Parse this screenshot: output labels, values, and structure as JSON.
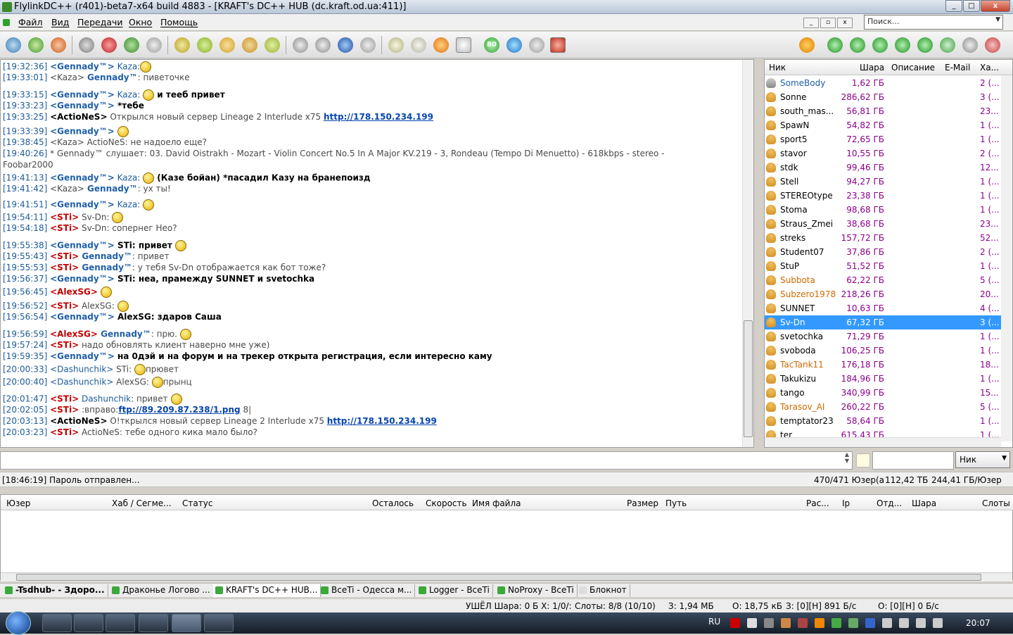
{
  "window": {
    "title": "FlylinkDC++ (r401)-beta7-x64 build 4883 - [KRAFT's DC++ HUB (dc.kraft.od.ua:411)]"
  },
  "menu": [
    "Файл",
    "Вид",
    "Передачи",
    "Окно",
    "Помощь"
  ],
  "search": {
    "placeholder": "Поиск..."
  },
  "toolbar": {
    "badge": "80"
  },
  "chat": [
    {
      "ts": "[19:32:36]",
      "parts": [
        [
          "n",
          "<Gennady™>"
        ],
        [
          "c",
          " Kaza:"
        ],
        [
          "s",
          ""
        ]
      ]
    },
    {
      "ts": "[19:33:01]",
      "parts": [
        [
          "g",
          "<Kaza>"
        ],
        [
          "n",
          " Gennady™"
        ],
        [
          "g",
          ": пиветочке"
        ]
      ]
    },
    {
      "ts": "[19:33:15]",
      "parts": [
        [
          "n",
          "<Gennady™>"
        ],
        [
          "c",
          " Kaza: "
        ],
        [
          "s",
          ""
        ],
        [
          "b",
          " и тееб привет"
        ]
      ]
    },
    {
      "ts": "[19:33:23]",
      "parts": [
        [
          "n",
          "<Gennady™>"
        ],
        [
          "b",
          " *тебе"
        ]
      ]
    },
    {
      "ts": "[19:33:25]",
      "parts": [
        [
          "b",
          "<ActioNeS>"
        ],
        [
          "g",
          " Открылся новый сервер Lineage 2 Interlude x75 "
        ],
        [
          "l",
          "http://178.150.234.199"
        ]
      ]
    },
    {
      "ts": "[19:33:39]",
      "parts": [
        [
          "n",
          "<Gennady™>"
        ],
        [
          "b",
          "  "
        ],
        [
          "s",
          ""
        ]
      ]
    },
    {
      "ts": "[19:38:45]",
      "parts": [
        [
          "g",
          "<Kaza>"
        ],
        [
          "g",
          " ActioNeS: не надоело еще?"
        ]
      ]
    },
    {
      "ts": "[19:40:26]",
      "parts": [
        [
          "g",
          " * Gennady™ слушает: 03. David Oistrakh - Mozart - Violin Concert No.5 In A Major KV.219 - 3, Rondeau (Tempo Di Menuetto) - 618kbps - stereo -"
        ]
      ]
    },
    {
      "ts": "",
      "parts": [
        [
          "g",
          "Foobar2000"
        ]
      ]
    },
    {
      "ts": "[19:41:13]",
      "parts": [
        [
          "n",
          "<Gennady™>"
        ],
        [
          "c",
          " Kaza: "
        ],
        [
          "s",
          ""
        ],
        [
          "b",
          " (Казе бойан) *пасадил Казу на бранепоизд"
        ]
      ]
    },
    {
      "ts": "[19:41:42]",
      "parts": [
        [
          "g",
          "<Kaza>"
        ],
        [
          "n",
          " Gennady™"
        ],
        [
          "g",
          ": ух ты!"
        ]
      ]
    },
    {
      "ts": "[19:41:51]",
      "parts": [
        [
          "n",
          "<Gennady™>"
        ],
        [
          "c",
          " Kaza: "
        ],
        [
          "s",
          ""
        ]
      ]
    },
    {
      "ts": "[19:54:11]",
      "parts": [
        [
          "r",
          "<STi>"
        ],
        [
          "g",
          " Sv-Dn: "
        ],
        [
          "s",
          ""
        ]
      ]
    },
    {
      "ts": "[19:54:18]",
      "parts": [
        [
          "r",
          "<STi>"
        ],
        [
          "g",
          " Sv-Dn: сопернег Нео?"
        ]
      ]
    },
    {
      "ts": "[19:55:38]",
      "parts": [
        [
          "n",
          "<Gennady™>"
        ],
        [
          "b",
          " STi: привет "
        ],
        [
          "s",
          ""
        ]
      ]
    },
    {
      "ts": "[19:55:43]",
      "parts": [
        [
          "r",
          "<STi>"
        ],
        [
          "n",
          " Gennady™"
        ],
        [
          "g",
          ": привет"
        ]
      ]
    },
    {
      "ts": "[19:55:53]",
      "parts": [
        [
          "r",
          "<STi>"
        ],
        [
          "n",
          " Gennady™"
        ],
        [
          "g",
          ": у тебя Sv-Dn отображается как бот тоже?"
        ]
      ]
    },
    {
      "ts": "[19:56:37]",
      "parts": [
        [
          "n",
          "<Gennady™>"
        ],
        [
          "b",
          " STi:  неа, прамежду SUNNET и svetochka"
        ]
      ]
    },
    {
      "ts": "[19:56:45]",
      "parts": [
        [
          "r",
          "<AlexSG>"
        ],
        [
          "g",
          " "
        ],
        [
          "s",
          ""
        ]
      ]
    },
    {
      "ts": "[19:56:52]",
      "parts": [
        [
          "r",
          "<STi>"
        ],
        [
          "g",
          " AlexSG: "
        ],
        [
          "s",
          ""
        ]
      ]
    },
    {
      "ts": "[19:56:54]",
      "parts": [
        [
          "n",
          "<Gennady™>"
        ],
        [
          "b",
          " AlexSG: здаров Саша"
        ]
      ]
    },
    {
      "ts": "[19:56:59]",
      "parts": [
        [
          "r",
          "<AlexSG>"
        ],
        [
          "n",
          " Gennady™"
        ],
        [
          "g",
          ": прю. "
        ],
        [
          "s",
          ""
        ]
      ]
    },
    {
      "ts": "[19:57:24]",
      "parts": [
        [
          "r",
          "<STi>"
        ],
        [
          "g",
          " надо обновлять клиент наверно мне уже)"
        ]
      ]
    },
    {
      "ts": "[19:59:35]",
      "parts": [
        [
          "n",
          "<Gennady™>"
        ],
        [
          "b",
          " на 0дэй и на форум и на трекер открыта регистрация, если интересно каму"
        ]
      ]
    },
    {
      "ts": "[20:00:33]",
      "parts": [
        [
          "c",
          "<Dashunchik>"
        ],
        [
          "g",
          " STi: "
        ],
        [
          "s",
          ""
        ],
        [
          "g",
          "прювет"
        ]
      ]
    },
    {
      "ts": "[20:00:40]",
      "parts": [
        [
          "c",
          "<Dashunchik>"
        ],
        [
          "g",
          " AlexSG: "
        ],
        [
          "s",
          ""
        ],
        [
          "g",
          "прынц"
        ]
      ]
    },
    {
      "ts": "[20:01:47]",
      "parts": [
        [
          "r",
          "<STi>"
        ],
        [
          "c",
          " Dashunchik"
        ],
        [
          "g",
          ": привет "
        ],
        [
          "s",
          ""
        ]
      ]
    },
    {
      "ts": "[20:02:05]",
      "parts": [
        [
          "r",
          "<STi>"
        ],
        [
          "g",
          " :вправо:"
        ],
        [
          "l",
          "ftp://89.209.87.238/1.png"
        ],
        [
          "g",
          " 8|"
        ]
      ]
    },
    {
      "ts": "[20:03:13]",
      "parts": [
        [
          "b",
          "<ActioNeS>"
        ],
        [
          "g",
          " О!ткрылся новый сервер Lineage 2 Interlude x75 "
        ],
        [
          "l",
          "http://178.150.234.199"
        ]
      ]
    },
    {
      "ts": "[20:03:23]",
      "parts": [
        [
          "r",
          "<STi>"
        ],
        [
          "g",
          " ActioNeS: тебе одного кика мало было?"
        ]
      ]
    }
  ],
  "userlist": {
    "headers": {
      "nick": "Ник",
      "share": "Шара",
      "desc": "Описание",
      "email": "E-Mail",
      "hub": "Ха..."
    },
    "rows": [
      {
        "nick": "SomeBody",
        "share": "1,62 ГБ",
        "hub": "2 (...",
        "color": "#1f5fa8"
      },
      {
        "nick": "Sonne",
        "share": "286,62 ГБ",
        "hub": "3 (..."
      },
      {
        "nick": "south_mas...",
        "share": "56,81 ГБ",
        "hub": "23..."
      },
      {
        "nick": "SpawN",
        "share": "54,82 ГБ",
        "hub": "1 (..."
      },
      {
        "nick": "sport5",
        "share": "72,65 ГБ",
        "hub": "1 (..."
      },
      {
        "nick": "stavor",
        "share": "10,55 ГБ",
        "hub": "2 (..."
      },
      {
        "nick": "stdk",
        "share": "99,46 ГБ",
        "hub": "12..."
      },
      {
        "nick": "Stell",
        "share": "94,27 ГБ",
        "hub": "1 (..."
      },
      {
        "nick": "STEREOtype",
        "share": "23,38 ГБ",
        "hub": "1 (..."
      },
      {
        "nick": "Stoma",
        "share": "98,68 ГБ",
        "hub": "1 (..."
      },
      {
        "nick": "Straus_Zmei",
        "share": "38,68 ГБ",
        "hub": "23..."
      },
      {
        "nick": "streks",
        "share": "157,72 ГБ",
        "hub": "52..."
      },
      {
        "nick": "Student07",
        "share": "37,86 ГБ",
        "hub": "2 (..."
      },
      {
        "nick": "StuP",
        "share": "51,52 ГБ",
        "hub": "1 (..."
      },
      {
        "nick": "Subbota",
        "share": "62,22 ГБ",
        "hub": "5 (...",
        "color": "#d06a00"
      },
      {
        "nick": "Subzero1978",
        "share": "218,26 ГБ",
        "hub": "20...",
        "color": "#d06a00"
      },
      {
        "nick": "SUNNET",
        "share": "10,63 ГБ",
        "hub": "4 (..."
      },
      {
        "nick": "Sv-Dn",
        "share": "67,32 ГБ",
        "hub": "3 (...",
        "sel": true
      },
      {
        "nick": "svetochka",
        "share": "71,29 ГБ",
        "hub": "1 (..."
      },
      {
        "nick": "svoboda",
        "share": "106,25 ГБ",
        "hub": "1 (..."
      },
      {
        "nick": "TacTank11",
        "share": "176,18 ГБ",
        "hub": "18...",
        "color": "#d06a00"
      },
      {
        "nick": "Takukizu",
        "share": "184,96 ГБ",
        "hub": "1 (..."
      },
      {
        "nick": "tango",
        "share": "340,99 ГБ",
        "hub": "15..."
      },
      {
        "nick": "Tarasov_AI",
        "share": "260,22 ГБ",
        "hub": "5 (...",
        "color": "#d06a00"
      },
      {
        "nick": "temptator23",
        "share": "58,64 ГБ",
        "hub": "1 (..."
      },
      {
        "nick": "ter",
        "share": "615,43 ГБ",
        "hub": "1 (..."
      }
    ]
  },
  "input": {
    "nick_select": "Ник"
  },
  "status": {
    "left": "[18:46:19] Пароль отправлен...",
    "users": "470/471 Юзер(а",
    "share": "112,42 ТБ",
    "avg": "244,41 ГБ/Юзер"
  },
  "transfers": {
    "headers": [
      "Юзер",
      "Хаб / Сегме...",
      "Статус",
      "Осталось",
      "Скорость",
      "Имя файла",
      "Размер",
      "Путь",
      "Рас...",
      "Ip",
      "Отд...",
      "Шара",
      "Слоты"
    ]
  },
  "tabs": [
    "-Tsdhub- - Здоро...",
    "Драконье Логово ...",
    "KRAFT's DC++ HUB...",
    "BceTi - Одесса м...",
    "Logger - BceTi",
    "NoProxy - BceTi",
    "Блокнот"
  ],
  "bottom": {
    "a": "УШЁЛ Шара: 0 Б Х: 1/0/:",
    "b": "Слоты: 8/8 (10/10)",
    "c": "З: 1,94 МБ",
    "d": "О: 18,75 кБ",
    "e": "З: [0][H] 891 Б/с",
    "f": "О: [0][H] 0 Б/с"
  },
  "taskbar": {
    "lang": "RU",
    "clock": "20:07"
  }
}
